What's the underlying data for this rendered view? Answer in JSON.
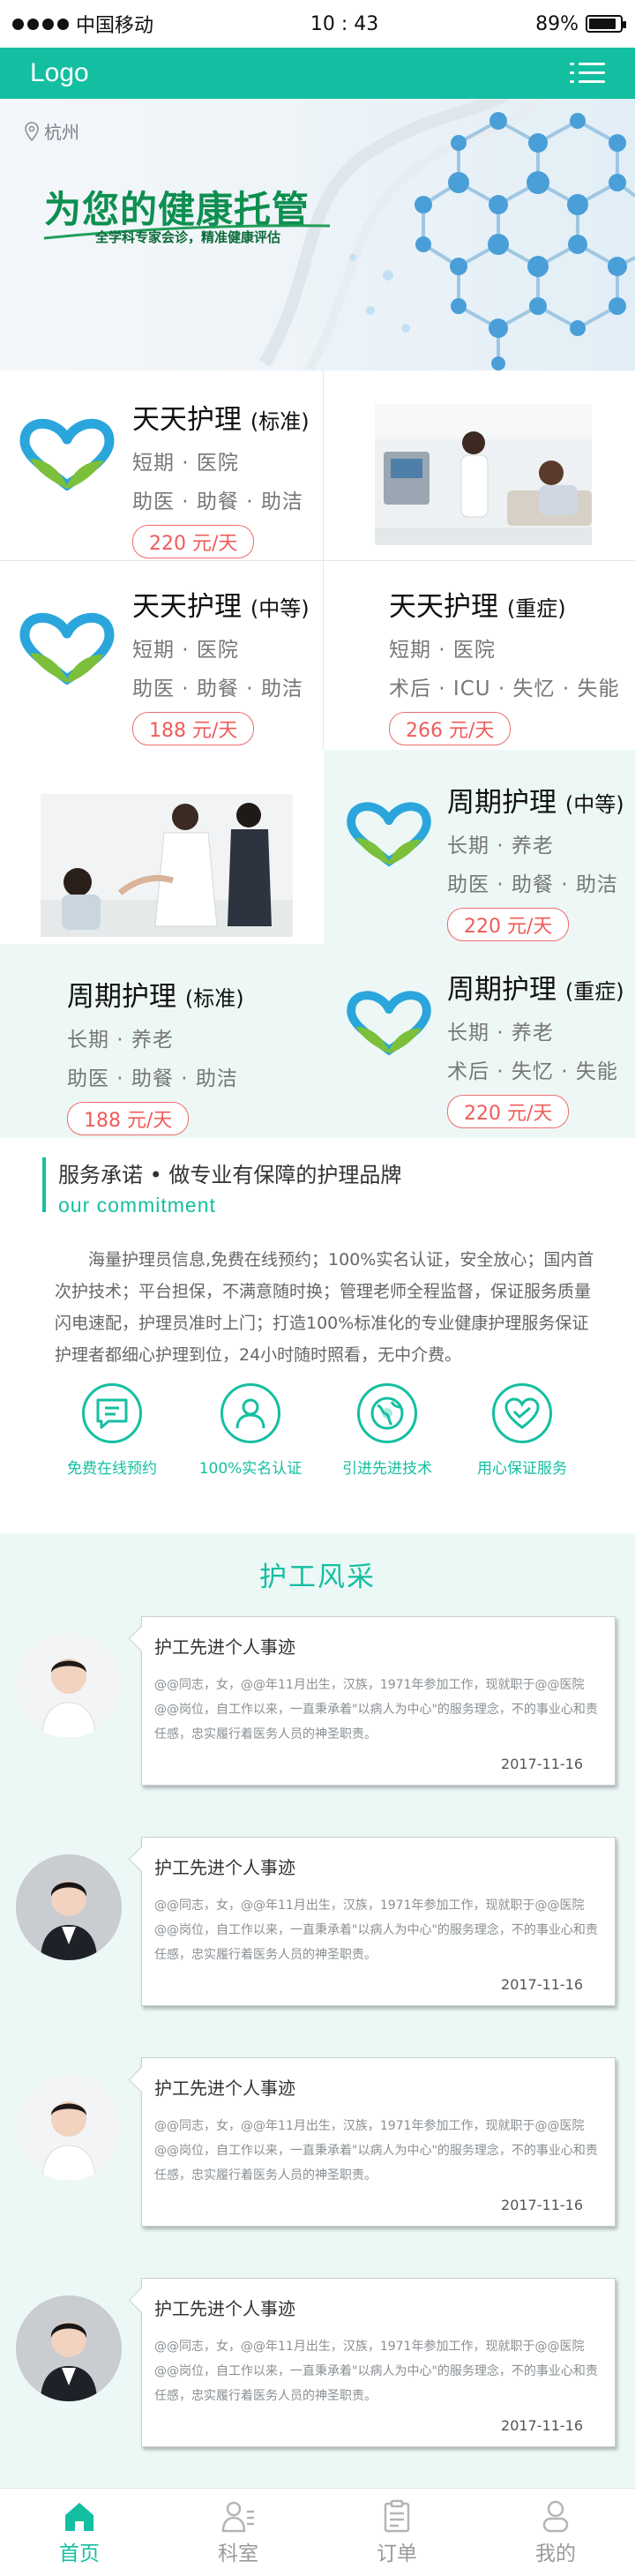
{
  "status_bar": {
    "carrier": "中国移动",
    "time": "10 : 43",
    "battery": "89%",
    "battery_level": 0.89
  },
  "header": {
    "logo": "Logo"
  },
  "banner": {
    "location": "杭州",
    "title": "为您的健康托管",
    "subtitle": "全学科专家会诊，精准健康评估"
  },
  "services": [
    {
      "name": "天天护理",
      "tier": "(标准)",
      "line1": "短期 · 医院",
      "line2": "助医 · 助餐 · 助洁",
      "price": "220 元/天"
    },
    {
      "name": "天天护理",
      "tier": "(中等)",
      "line1": "短期 · 医院",
      "line2": "助医 · 助餐 · 助洁",
      "price": "188 元/天"
    },
    {
      "name": "天天护理",
      "tier": "(重症)",
      "line1": "短期 · 医院",
      "line2": "术后 · ICU · 失忆 · 失能",
      "price": "266 元/天"
    },
    {
      "name": "周期护理",
      "tier": "(中等)",
      "line1": "长期 · 养老",
      "line2": "助医 · 助餐 · 助洁",
      "price": "220 元/天"
    },
    {
      "name": "周期护理",
      "tier": "(标准)",
      "line1": "长期 · 养老",
      "line2": "助医 · 助餐 · 助洁",
      "price": "188 元/天"
    },
    {
      "name": "周期护理",
      "tier": "(重症)",
      "line1": "长期 · 养老",
      "line2": "术后 · 失忆 · 失能",
      "price": "220 元/天"
    }
  ],
  "commitment": {
    "title": "服务承诺 • 做专业有保障的护理品牌",
    "subtitle_en": "our commitment",
    "description": "海量护理员信息,免费在线预约；100%实名认证，安全放心；国内首次护技术；平台担保，不满意随时换；管理老师全程监督，保证服务质量闪电速配，护理员准时上门；打造100%标准化的专业健康护理服务保证护理者都细心护理到位，24小时随时照看，无中介费。",
    "features": [
      {
        "label": "免费在线预约",
        "icon": "chat-icon"
      },
      {
        "label": "100%实名认证",
        "icon": "user-icon"
      },
      {
        "label": "引进先进技术",
        "icon": "globe-icon"
      },
      {
        "label": "用心保证服务",
        "icon": "heart-icon"
      }
    ]
  },
  "nurse_section": {
    "title": "护工风采",
    "stories": [
      {
        "title": "护工先进个人事迹",
        "body": "@@同志，女，@@年11月出生，汉族，1971年参加工作，现就职于@@医院@@岗位，自工作以来，一直秉承着\"以病人为中心\"的服务理念，不的事业心和责任感，忠实履行着医务人员的神圣职责。",
        "date": "2017-11-16"
      },
      {
        "title": "护工先进个人事迹",
        "body": "@@同志，女，@@年11月出生，汉族，1971年参加工作，现就职于@@医院@@岗位，自工作以来，一直秉承着\"以病人为中心\"的服务理念，不的事业心和责任感，忠实履行着医务人员的神圣职责。",
        "date": "2017-11-16"
      },
      {
        "title": "护工先进个人事迹",
        "body": "@@同志，女，@@年11月出生，汉族，1971年参加工作，现就职于@@医院@@岗位，自工作以来，一直秉承着\"以病人为中心\"的服务理念，不的事业心和责任感，忠实履行着医务人员的神圣职责。",
        "date": "2017-11-16"
      },
      {
        "title": "护工先进个人事迹",
        "body": "@@同志，女，@@年11月出生，汉族，1971年参加工作，现就职于@@医院@@岗位，自工作以来，一直秉承着\"以病人为中心\"的服务理念，不的事业心和责任感，忠实履行着医务人员的神圣职责。",
        "date": "2017-11-16"
      }
    ]
  },
  "tabbar": [
    {
      "label": "首页",
      "icon": "home-icon",
      "active": true
    },
    {
      "label": "科室",
      "icon": "department-icon",
      "active": false
    },
    {
      "label": "订单",
      "icon": "order-icon",
      "active": false
    },
    {
      "label": "我的",
      "icon": "profile-icon",
      "active": false
    }
  ],
  "colors": {
    "accent": "#14bfa1",
    "price": "#ef5b5b",
    "heart_blue": "#2aa6dc",
    "heart_green": "#7cbf3a"
  }
}
